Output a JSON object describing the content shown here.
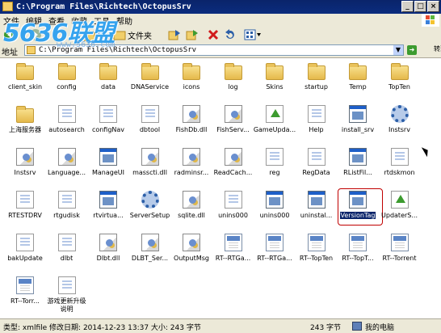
{
  "window": {
    "title": "C:\\Program Files\\Richtech\\OctopusSrv",
    "min_glyph": "_",
    "max_glyph": "□",
    "close_glyph": "×"
  },
  "menu": [
    "文件",
    "编辑",
    "查看",
    "收藏",
    "工具",
    "帮助"
  ],
  "toolbar": {
    "folders_label": "文件夹",
    "icons": [
      "back-icon",
      "forward-icon",
      "up-folder-icon",
      "search-icon",
      "folders-icon",
      "move-to-icon",
      "copy-to-icon",
      "delete-icon",
      "undo-icon",
      "views-icon"
    ]
  },
  "address": {
    "label": "地址",
    "value": "C:\\Program Files\\Richtech\\OctopusSrv",
    "go_label": "转到"
  },
  "watermark": {
    "text": "5636联盟",
    "url": "www.5636.com"
  },
  "files": [
    {
      "name": "client_skin",
      "kind": "folder"
    },
    {
      "name": "config",
      "kind": "folder"
    },
    {
      "name": "data",
      "kind": "folder"
    },
    {
      "name": "DNAService",
      "kind": "folder"
    },
    {
      "name": "icons",
      "kind": "folder"
    },
    {
      "name": "log",
      "kind": "folder"
    },
    {
      "name": "Skins",
      "kind": "folder"
    },
    {
      "name": "startup",
      "kind": "folder"
    },
    {
      "name": "Temp",
      "kind": "folder"
    },
    {
      "name": "TopTen",
      "kind": "folder"
    },
    {
      "name": "上海服务器",
      "kind": "folder"
    },
    {
      "name": "autosearch",
      "kind": "gen"
    },
    {
      "name": "configNav",
      "kind": "gen"
    },
    {
      "name": "dbtool",
      "kind": "gen"
    },
    {
      "name": "FishDb.dll",
      "kind": "dll"
    },
    {
      "name": "FishServ...",
      "kind": "dll"
    },
    {
      "name": "GameUpda...",
      "kind": "update"
    },
    {
      "name": "Help",
      "kind": "gen"
    },
    {
      "name": "install_srv",
      "kind": "exe"
    },
    {
      "name": "Instsrv",
      "kind": "gear"
    },
    {
      "name": "Instsrv",
      "kind": "dll"
    },
    {
      "name": "Language...",
      "kind": "dll"
    },
    {
      "name": "ManageUI",
      "kind": "exe"
    },
    {
      "name": "masscti.dll",
      "kind": "dll"
    },
    {
      "name": "radminsr...",
      "kind": "dll"
    },
    {
      "name": "ReadCach...",
      "kind": "dll"
    },
    {
      "name": "reg",
      "kind": "gen"
    },
    {
      "name": "RegData",
      "kind": "gen"
    },
    {
      "name": "RListFil...",
      "kind": "exe"
    },
    {
      "name": "rtdskmon",
      "kind": "gen"
    },
    {
      "name": "RTESTDRV",
      "kind": "gen"
    },
    {
      "name": "rtgudisk",
      "kind": "gen"
    },
    {
      "name": "rtvirtua...",
      "kind": "exe"
    },
    {
      "name": "ServerSetup",
      "kind": "gear"
    },
    {
      "name": "sqlite.dll",
      "kind": "dll"
    },
    {
      "name": "unins000",
      "kind": "gen"
    },
    {
      "name": "unins000",
      "kind": "exe"
    },
    {
      "name": "uninstal...",
      "kind": "exe"
    },
    {
      "name": "VersionTag",
      "kind": "exe",
      "selected": true
    },
    {
      "name": "UpdaterS...",
      "kind": "update"
    },
    {
      "name": "bakUpdate",
      "kind": "gen"
    },
    {
      "name": "dlbt",
      "kind": "gen"
    },
    {
      "name": "Dlbt.dll",
      "kind": "dll"
    },
    {
      "name": "DLBT_Ser...",
      "kind": "dll"
    },
    {
      "name": "OutputMsg",
      "kind": "dll"
    },
    {
      "name": "RT--RTGa...",
      "kind": "rt"
    },
    {
      "name": "RT--RTGa...",
      "kind": "rt"
    },
    {
      "name": "RT--TopTen",
      "kind": "rt"
    },
    {
      "name": "RT--TopT...",
      "kind": "rt"
    },
    {
      "name": "RT--Torrent",
      "kind": "rt"
    },
    {
      "name": "RT--Torr...",
      "kind": "rt"
    },
    {
      "name": "游戏更新升级说明",
      "kind": "gen"
    }
  ],
  "status": {
    "details": "类型: xmlfile 修改日期: 2014-12-23 13:37 大小: 243 字节",
    "size": "243 字节",
    "location": "我的电脑"
  }
}
